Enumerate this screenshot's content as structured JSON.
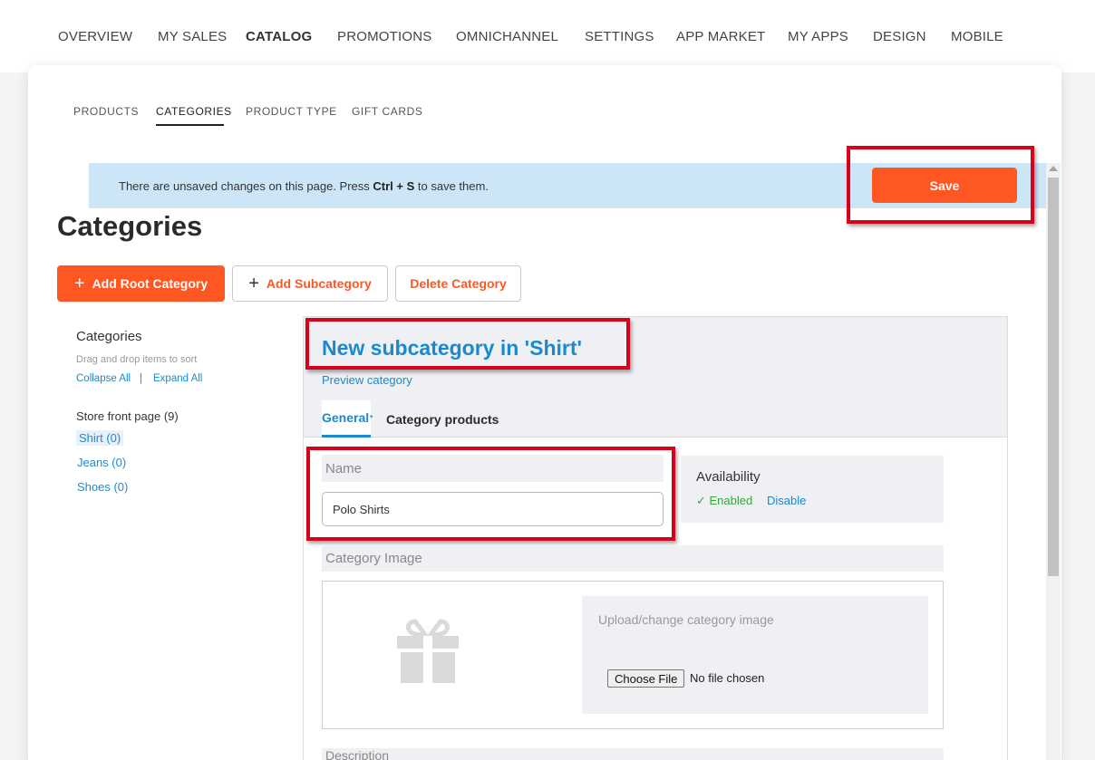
{
  "topnav": [
    "OVERVIEW",
    "MY SALES",
    "CATALOG",
    "PROMOTIONS",
    "OMNICHANNEL",
    "SETTINGS",
    "APP MARKET",
    "MY APPS",
    "DESIGN",
    "MOBILE"
  ],
  "subnav": [
    "PRODUCTS",
    "CATEGORIES",
    "PRODUCT TYPE",
    "GIFT CARDS"
  ],
  "banner": {
    "prefix": "There are unsaved changes on this page. Press ",
    "shortcut": "Ctrl + S",
    "suffix": " to save them.",
    "save_label": "Save"
  },
  "page_title": "Categories",
  "actions": {
    "add_root": "Add Root Category",
    "add_sub": "Add Subcategory",
    "delete": "Delete Category"
  },
  "tree": {
    "title": "Categories",
    "hint": "Drag and drop items to sort",
    "collapse": "Collapse All",
    "separator": "|",
    "expand": "Expand All",
    "root": "Store front page (9)",
    "items": [
      "Shirt (0)",
      "Jeans (0)",
      "Shoes (0)"
    ]
  },
  "editor": {
    "title": "New subcategory in 'Shirt'",
    "preview": "Preview category",
    "tab_general": "General",
    "tab_general_mark": "*",
    "tab_products": "Category products",
    "name_label": "Name",
    "name_value": "Polo Shirts",
    "availability_title": "Availability",
    "enabled": "✓ Enabled",
    "disable": "Disable",
    "image_label": "Category Image",
    "upload_label": "Upload/change category image",
    "choose_file": "Choose File",
    "no_file": "No file chosen",
    "description_label": "Description"
  },
  "colors": {
    "accent": "#ff5722",
    "link": "#1a8ad0",
    "banner": "#cde6f7",
    "highlight": "#d9001b"
  }
}
